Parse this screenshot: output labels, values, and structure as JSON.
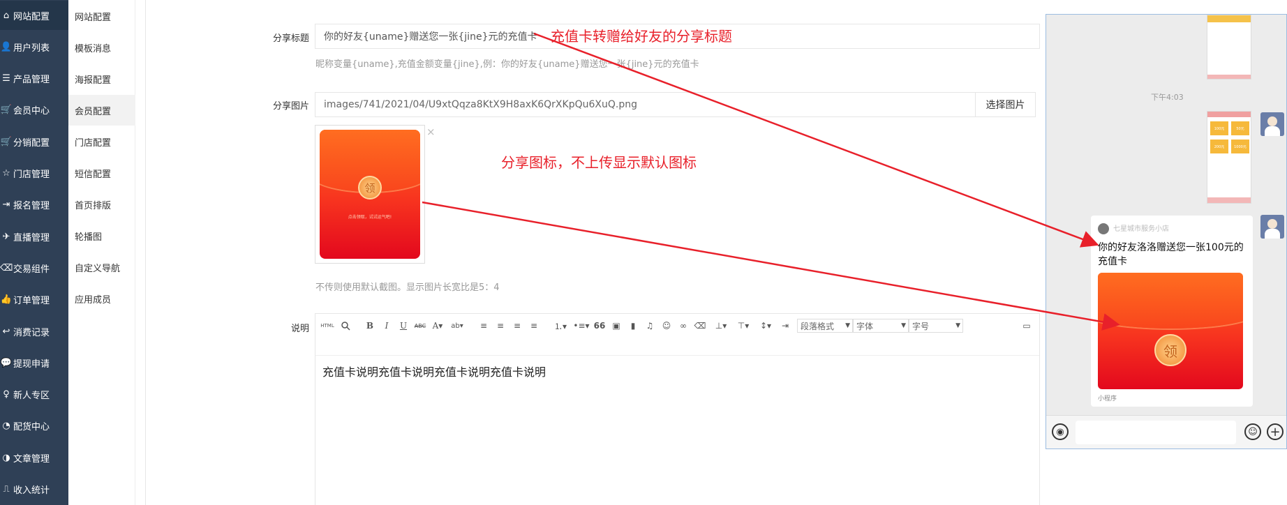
{
  "sidebar": {
    "items": [
      {
        "label": "网站配置",
        "icon": "home-icon",
        "glyph": "⌂"
      },
      {
        "label": "用户列表",
        "icon": "user-icon",
        "glyph": "👤"
      },
      {
        "label": "产品管理",
        "icon": "list-icon",
        "glyph": "☰"
      },
      {
        "label": "会员中心",
        "icon": "cart-icon",
        "glyph": "🛒"
      },
      {
        "label": "分销配置",
        "icon": "cart-icon",
        "glyph": "🛒"
      },
      {
        "label": "门店管理",
        "icon": "star-icon",
        "glyph": "☆"
      },
      {
        "label": "报名管理",
        "icon": "sign-in-icon",
        "glyph": "⇥"
      },
      {
        "label": "直播管理",
        "icon": "plane-icon",
        "glyph": "✈"
      },
      {
        "label": "交易组件",
        "icon": "eraser-icon",
        "glyph": "⌫"
      },
      {
        "label": "订单管理",
        "icon": "thumbs-up-icon",
        "glyph": "👍"
      },
      {
        "label": "消费记录",
        "icon": "reply-icon",
        "glyph": "↩"
      },
      {
        "label": "提现申请",
        "icon": "comments-icon",
        "glyph": "💬"
      },
      {
        "label": "新人专区",
        "icon": "map-marker-icon",
        "glyph": "♀"
      },
      {
        "label": "配货中心",
        "icon": "pie-chart-icon",
        "glyph": "◔"
      },
      {
        "label": "文章管理",
        "icon": "adjust-icon",
        "glyph": "◑"
      },
      {
        "label": "收入统计",
        "icon": "level-icon",
        "glyph": "⎍"
      }
    ]
  },
  "submenu": {
    "items": [
      "网站配置",
      "模板消息",
      "海报配置",
      "会员配置",
      "门店配置",
      "短信配置",
      "首页排版",
      "轮播图",
      "自定义导航",
      "应用成员"
    ]
  },
  "form": {
    "share_title_label": "分享标题",
    "share_title_value": "你的好友{uname}赠送您一张{jine}元的充值卡",
    "share_title_hint": "昵称变量{uname},充值金额变量{jine},例：你的好友{uname}赠送您一张{jine}元的充值卡",
    "share_image_label": "分享图片",
    "share_image_value": "images/741/2021/04/U9xtQqza8KtX9H8axK6QrXKpQu6XuQ.png",
    "select_image_button": "选择图片",
    "remove_glyph": "×",
    "image_hint": "不传则使用默认截图。显示图片长宽比是5：4",
    "redpack_char": "领",
    "redpack_small_text": "点击领取，试试运气吧!",
    "desc_label": "说明",
    "desc_body": "充值卡说明充值卡说明充值卡说明充值卡说明"
  },
  "editor": {
    "para_format": "段落格式",
    "font_family": "字体",
    "font_size": "字号",
    "html_label": "HTML",
    "bold": "B",
    "italic": "I",
    "underline": "U",
    "strike": "ABC",
    "quote": "66"
  },
  "annotations": {
    "title_note": "充值卡转赠给好友的分享标题",
    "icon_note": "分享图标，不上传显示默认图标",
    "arrow_color": "#e8202a"
  },
  "phone": {
    "time": "下午4:03",
    "share_source": "七星城市服务小店",
    "share_title": "你的好友洛洛赠送您一张100元的充值卡",
    "footer": "小程序",
    "mini_price_labels": [
      "100元",
      "50元",
      "200元",
      "1000元"
    ],
    "voice_glyph": "◉",
    "emoji_glyph": "☺",
    "plus_glyph": "+"
  }
}
